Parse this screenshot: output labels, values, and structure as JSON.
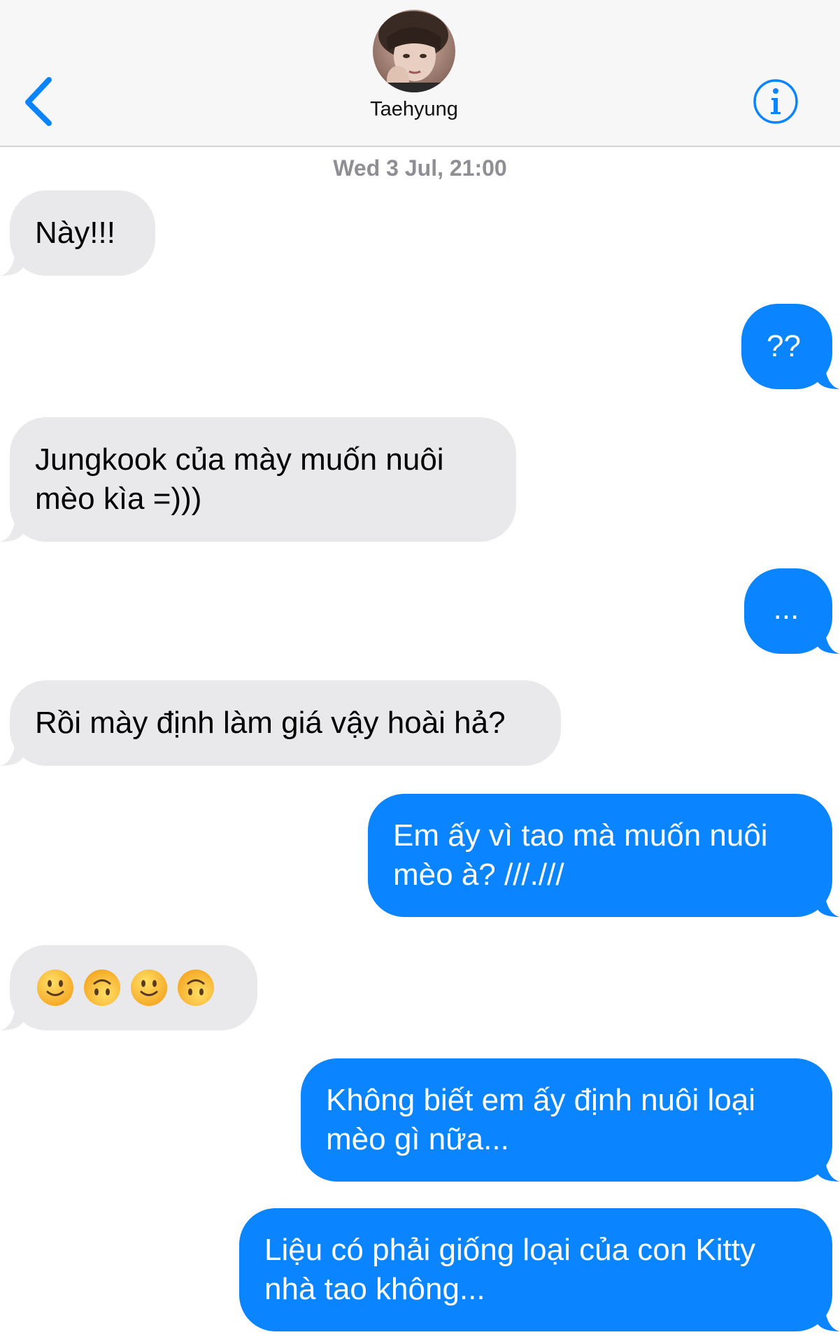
{
  "header": {
    "contact_name": "Taehyung",
    "back_icon": "chevron-left-icon",
    "info_icon": "info-icon",
    "accent_color": "#0a84ff"
  },
  "thread": {
    "timestamp": "Wed 3 Jul, 21:00",
    "messages": [
      {
        "from": "them",
        "text": "Này!!!"
      },
      {
        "from": "me",
        "text": "??"
      },
      {
        "from": "them",
        "text": "Jungkook của mày muốn nuôi\nmèo kìa =)))"
      },
      {
        "from": "me",
        "text": "..."
      },
      {
        "from": "them",
        "text": "Rồi mày định làm giá vậy hoài hả?"
      },
      {
        "from": "me",
        "text": "Em ấy vì tao mà muốn nuôi\nmèo à? ///.///"
      },
      {
        "from": "them",
        "emojis": [
          "slightly-smiling-face",
          "upside-down-face",
          "slightly-smiling-face",
          "upside-down-face"
        ]
      },
      {
        "from": "me",
        "text": "Không biết em ấy định nuôi loại\nmèo gì nữa..."
      },
      {
        "from": "me",
        "text": "Liệu có phải giống loại của con Kitty\nnhà tao không..."
      }
    ]
  },
  "colors": {
    "incoming_bubble": "#e9e9eb",
    "outgoing_bubble": "#0a84ff",
    "timestamp_text": "#8e8e93"
  }
}
